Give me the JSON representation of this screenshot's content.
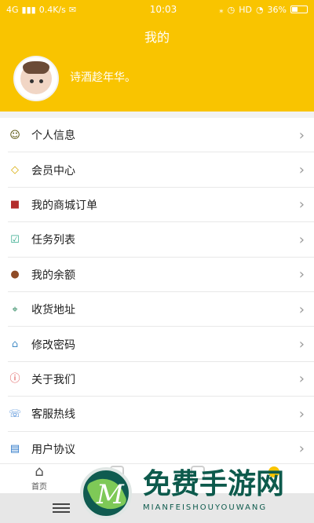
{
  "status": {
    "network": "4G",
    "speed": "0.4K/s",
    "time": "10:03",
    "hd": "HD",
    "battery": "36%"
  },
  "header": {
    "title": "我的",
    "username": "诗酒趁年华。"
  },
  "menu": {
    "items": [
      {
        "label": "个人信息",
        "icon": "user-icon"
      },
      {
        "label": "会员中心",
        "icon": "diamond-icon"
      },
      {
        "label": "我的商城订单",
        "icon": "order-icon"
      },
      {
        "label": "任务列表",
        "icon": "task-icon"
      },
      {
        "label": "我的余额",
        "icon": "balance-icon"
      },
      {
        "label": "收货地址",
        "icon": "location-icon"
      },
      {
        "label": "修改密码",
        "icon": "lock-icon"
      },
      {
        "label": "关于我们",
        "icon": "info-icon"
      },
      {
        "label": "客服热线",
        "icon": "phone-icon"
      },
      {
        "label": "用户协议",
        "icon": "document-icon"
      }
    ]
  },
  "tabbar": {
    "home_label": "首页"
  },
  "watermark": {
    "title": "免费手游网",
    "subtitle": "MIANFEISHOUYOUWANG"
  },
  "colors": {
    "accent": "#f9c400",
    "watermark": "#0d5a4c"
  }
}
